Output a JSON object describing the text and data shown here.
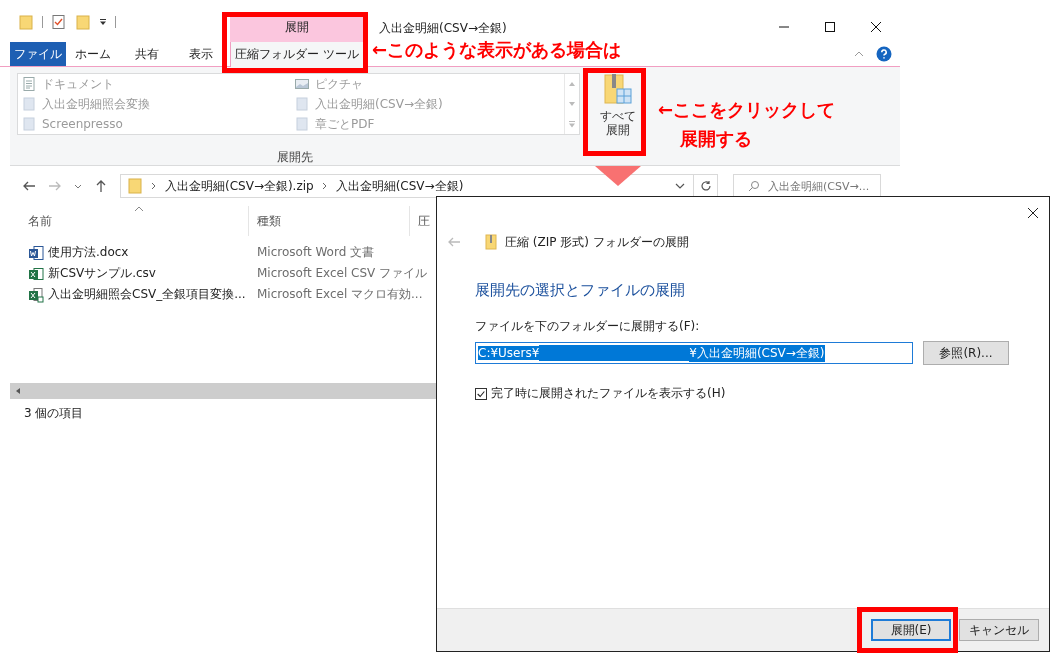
{
  "window": {
    "title": "入出金明細(CSV→全銀)"
  },
  "context_tab_group": {
    "label": "展開"
  },
  "tabs": [
    {
      "label": "ファイル",
      "kind": "file",
      "selected": false
    },
    {
      "label": "ホーム",
      "kind": "tab",
      "selected": false
    },
    {
      "label": "共有",
      "kind": "tab",
      "selected": false
    },
    {
      "label": "表示",
      "kind": "tab",
      "selected": false
    },
    {
      "label": "圧縮フォルダー ツール",
      "kind": "context",
      "selected": true
    }
  ],
  "ribbon": {
    "destinations": [
      {
        "label": "ドキュメント",
        "kind": "document"
      },
      {
        "label": "入出金明細照会変換",
        "kind": "folder"
      },
      {
        "label": "Screenpresso",
        "kind": "folder"
      },
      {
        "label": "ピクチャ",
        "kind": "pictures"
      },
      {
        "label": "入出金明細(CSV→全銀)",
        "kind": "folder"
      },
      {
        "label": "章ごとPDF",
        "kind": "folder"
      }
    ],
    "extract_all_lines": [
      "すべて",
      "展開"
    ],
    "group_label": "展開先"
  },
  "address_bar": {
    "path": [
      "入出金明細(CSV→全銀).zip",
      "入出金明細(CSV→全銀)"
    ],
    "search_placeholder": "入出金明細(CSV→..."
  },
  "file_list": {
    "columns": [
      {
        "label": "名前",
        "sorted": true
      },
      {
        "label": "種類",
        "sorted": false
      },
      {
        "label": "圧",
        "sorted": false
      }
    ],
    "rows": [
      {
        "name": "使用方法.docx",
        "type": "Microsoft Word 文書",
        "kind": "word"
      },
      {
        "name": "新CSVサンプル.csv",
        "type": "Microsoft Excel CSV ファイル",
        "kind": "csv"
      },
      {
        "name": "入出金明細照会CSV_全銀項目変換...",
        "type": "Microsoft Excel マクロ有効...",
        "kind": "macro"
      }
    ]
  },
  "status_bar": "3 個の項目",
  "dialog": {
    "title": "圧縮 (ZIP 形式) フォルダーの展開",
    "heading": "展開先の選択とファイルの展開",
    "field_label": "ファイルを下のフォルダーに展開する(F):",
    "path_start": "C:¥Users¥",
    "path_end": "¥入出金明細(CSV→全銀)",
    "browse_button": "参照(R)...",
    "show_files": {
      "label": "完了時に展開されたファイルを表示する(H)",
      "checked": true
    },
    "buttons": [
      {
        "label": "展開(E)",
        "kind": "default"
      },
      {
        "label": "キャンセル",
        "kind": "normal"
      }
    ]
  },
  "annotations": [
    "←このような表示がある場合は",
    "←ここをクリックして",
    "展開する"
  ]
}
